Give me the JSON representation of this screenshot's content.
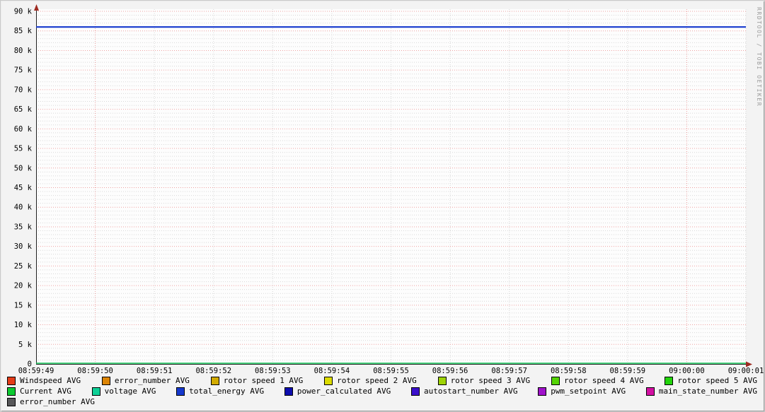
{
  "watermark": "RRDTOOL / TOBI OETIKER",
  "colors": {
    "background": "#f3f3f3",
    "canvas": "#fdfdfd",
    "axis": "#222222",
    "arrow": "#9e2a20",
    "grid_major": "#efa2a2",
    "grid_minor": "#d9d9d9",
    "label": "#000000"
  },
  "chart_data": {
    "type": "line",
    "x_tick_labels": [
      "08:59:49",
      "08:59:50",
      "08:59:51",
      "08:59:52",
      "08:59:53",
      "08:59:54",
      "08:59:55",
      "08:59:56",
      "08:59:57",
      "08:59:58",
      "08:59:59",
      "09:00:00",
      "09:00:01"
    ],
    "x_major_tick_labels": [
      "08:59:50",
      "09:00:00"
    ],
    "y_tick_labels": [
      "0",
      "5 k",
      "10 k",
      "15 k",
      "20 k",
      "25 k",
      "30 k",
      "35 k",
      "40 k",
      "45 k",
      "50 k",
      "55 k",
      "60 k",
      "65 k",
      "70 k",
      "75 k",
      "80 k",
      "85 k",
      "90 k"
    ],
    "y_axis": {
      "min": 0,
      "max": 90000,
      "major_step": 5000,
      "minor_step": 1000
    },
    "series": [
      {
        "name": "Windspeed AVG",
        "color": "#e43c19",
        "value": 0
      },
      {
        "name": "error_number AVG",
        "color": "#dd8505",
        "value": 0
      },
      {
        "name": "rotor speed 1 AVG",
        "color": "#d2ab00",
        "value": 0
      },
      {
        "name": "rotor speed 2 AVG",
        "color": "#dcdc00",
        "value": 0
      },
      {
        "name": "rotor speed 3 AVG",
        "color": "#9ed305",
        "value": 0
      },
      {
        "name": "rotor speed 4 AVG",
        "color": "#55d405",
        "value": 0
      },
      {
        "name": "rotor speed 5 AVG",
        "color": "#22d40b",
        "value": 0
      },
      {
        "name": "Current AVG",
        "color": "#0cca31",
        "value": 0
      },
      {
        "name": "voltage AVG",
        "color": "#0fd096",
        "value": 0
      },
      {
        "name": "total_energy AVG",
        "color": "#1538cd",
        "value": 86000
      },
      {
        "name": "power_calculated AVG",
        "color": "#0d0dae",
        "value": 0
      },
      {
        "name": "autostart_number AVG",
        "color": "#3a10cb",
        "value": 0
      },
      {
        "name": "pwm_setpoint AVG",
        "color": "#a012cb",
        "value": 0
      },
      {
        "name": "main_state_number AVG",
        "color": "#d310a2",
        "value": 0
      },
      {
        "name": "error_number AVG",
        "color": "#58585a",
        "value": 0
      }
    ],
    "visible_lines": [
      {
        "series": "total_energy AVG",
        "value": 86000,
        "color": "#1538cd",
        "width": 2.2
      },
      {
        "series": "Current AVG",
        "value": 0,
        "color": "#0bc152",
        "width": 1.6
      }
    ],
    "grid": true,
    "legend_position": "bottom"
  },
  "legend": {
    "rows": [
      [
        {
          "label": "Windspeed AVG",
          "color": "#e43c19"
        },
        {
          "label": "error_number AVG",
          "color": "#dd8505"
        },
        {
          "label": "rotor speed 1 AVG",
          "color": "#d2ab00"
        },
        {
          "label": "rotor speed 2 AVG",
          "color": "#dcdc00"
        },
        {
          "label": "rotor speed 3 AVG",
          "color": "#9ed305"
        },
        {
          "label": "rotor speed 4 AVG",
          "color": "#55d405"
        },
        {
          "label": "rotor speed 5 AVG",
          "color": "#22d40b"
        }
      ],
      [
        {
          "label": "Current AVG",
          "color": "#0cca31"
        },
        {
          "label": "voltage AVG",
          "color": "#0fd096"
        },
        {
          "label": "total_energy AVG",
          "color": "#1538cd"
        },
        {
          "label": "power_calculated AVG",
          "color": "#0d0dae"
        },
        {
          "label": "autostart_number AVG",
          "color": "#3a10cb"
        },
        {
          "label": "pwm_setpoint AVG",
          "color": "#a012cb"
        },
        {
          "label": "main_state_number AVG",
          "color": "#d310a2"
        }
      ],
      [
        {
          "label": "error_number AVG",
          "color": "#58585a"
        }
      ]
    ]
  }
}
